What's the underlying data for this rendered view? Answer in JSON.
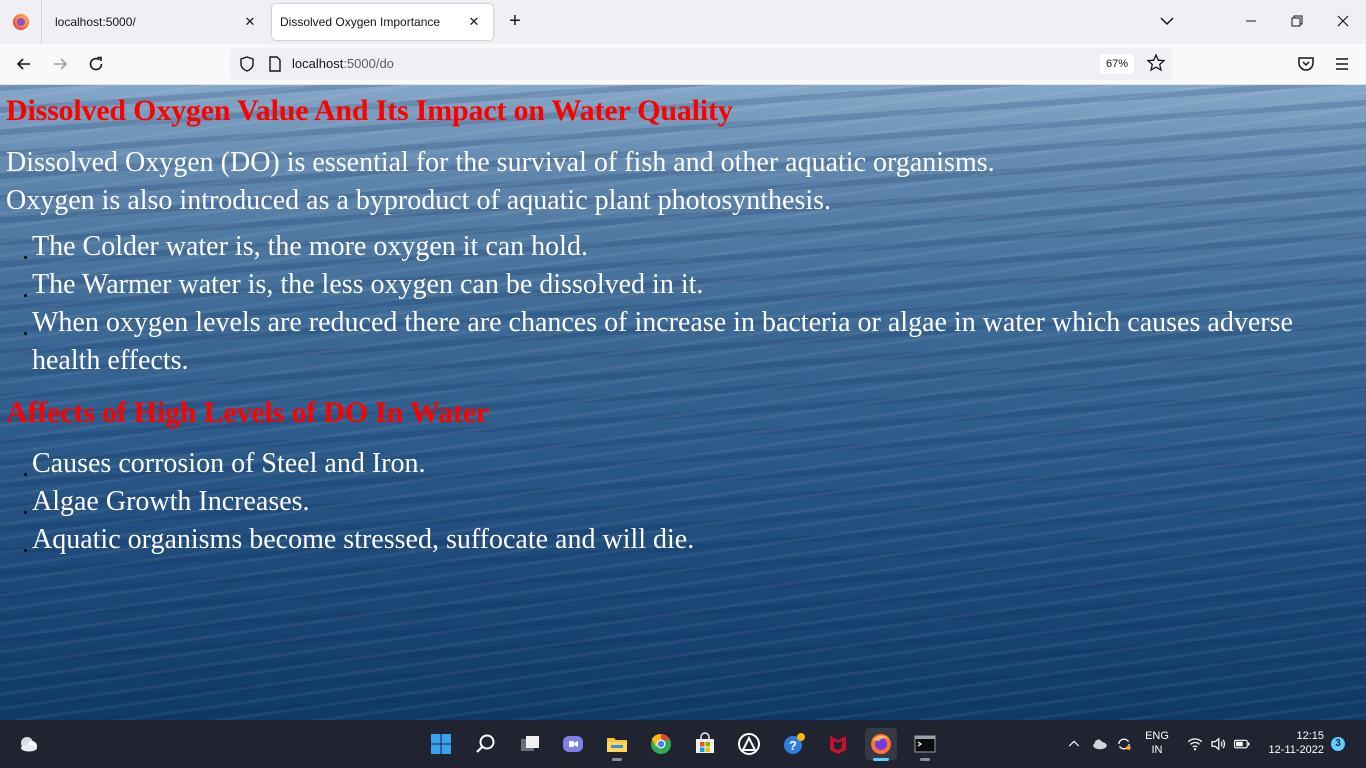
{
  "browser": {
    "tabs": [
      {
        "title": "localhost:5000/",
        "active": false
      },
      {
        "title": "Dissolved Oxygen Importance",
        "active": true
      }
    ],
    "url_host": "localhost",
    "url_path": ":5000/do",
    "zoom": "67%"
  },
  "page": {
    "heading1": "Dissolved Oxygen Value And Its Impact on Water Quality",
    "intro_line1": "Dissolved Oxygen (DO) is essential for the survival of fish and other aquatic organisms.",
    "intro_line2": "Oxygen is also introduced as a byproduct of aquatic plant photosynthesis.",
    "list1": [
      "The Colder water is, the more oxygen it can hold.",
      "The Warmer water is, the less oxygen can be dissolved in it.",
      "When oxygen levels are reduced there are chances of increase in bacteria or algae in water which causes adverse health effects."
    ],
    "heading2": "Affects of High Levels of DO In Water",
    "list2": [
      "Causes corrosion of Steel and Iron.",
      "Algae Growth Increases.",
      "Aquatic organisms become stressed, suffocate and will die."
    ]
  },
  "taskbar": {
    "language": "ENG",
    "region": "IN",
    "time": "12:15",
    "date": "12-11-2022",
    "notifications": "3"
  },
  "colors": {
    "heading": "#ff0000",
    "text": "#ffffff",
    "taskbar": "#1f2430",
    "accent": "#60cdff"
  }
}
